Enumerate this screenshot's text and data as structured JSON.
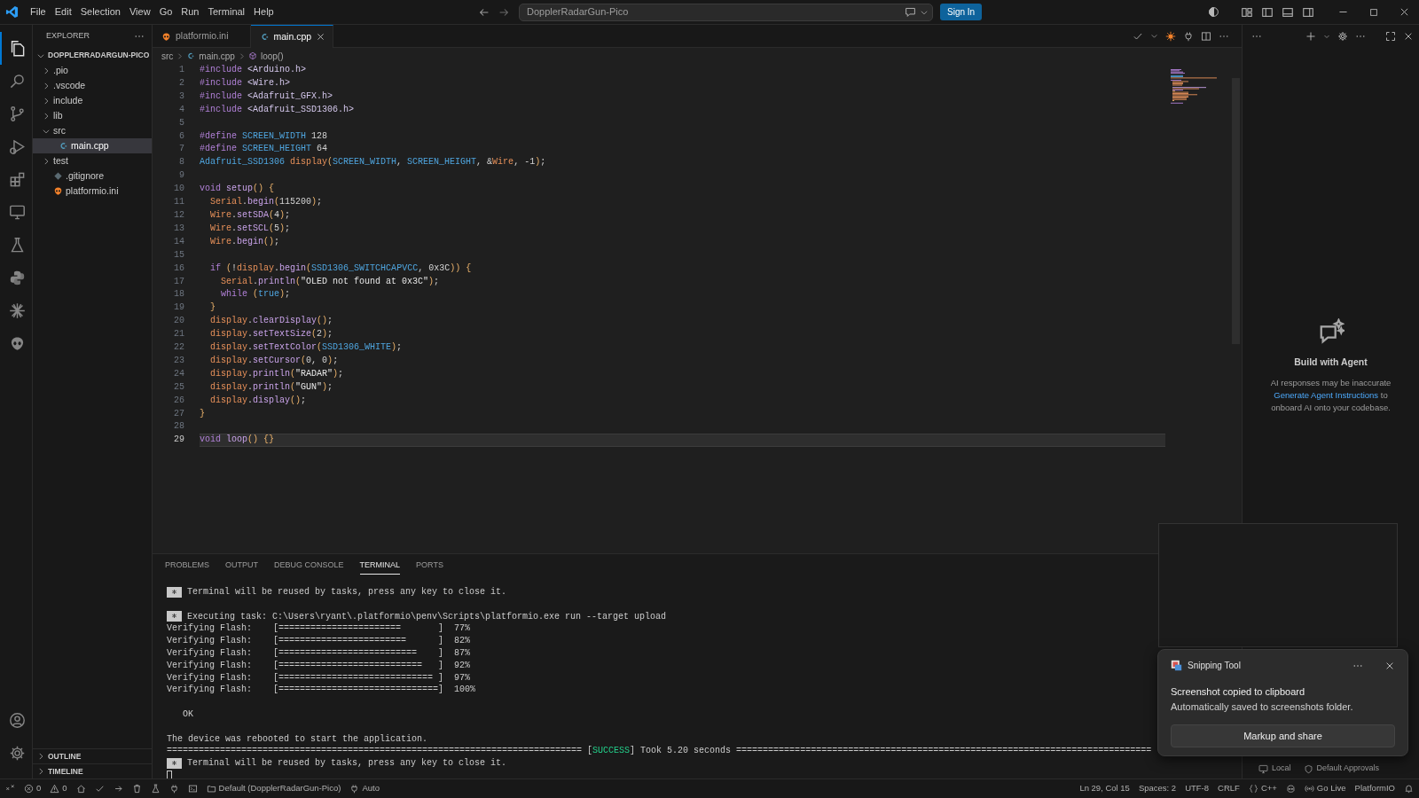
{
  "title_bar": {
    "menu": [
      "File",
      "Edit",
      "Selection",
      "View",
      "Go",
      "Run",
      "Terminal",
      "Help"
    ],
    "search": "DopplerRadarGun-Pico",
    "sign_in": "Sign In"
  },
  "activity_bar": [
    {
      "kind": "explorer",
      "selected": true
    },
    {
      "kind": "search",
      "selected": false
    },
    {
      "kind": "source_control",
      "selected": false
    },
    {
      "kind": "run",
      "selected": false
    },
    {
      "kind": "extensions",
      "selected": false
    },
    {
      "kind": "remote",
      "selected": false
    },
    {
      "kind": "testing",
      "selected": false
    },
    {
      "kind": "python",
      "selected": false
    },
    {
      "kind": "burst",
      "selected": false
    },
    {
      "kind": "platformio",
      "selected": false
    }
  ],
  "sidebar": {
    "title": "EXPLORER",
    "tree": [
      {
        "label": "DOPPLERRADARGUN-PICO",
        "kind": "root",
        "expanded": true,
        "selected": false,
        "children": [
          {
            "label": ".pio",
            "kind": "folder",
            "expanded": false,
            "selected": false
          },
          {
            "label": ".vscode",
            "kind": "folder",
            "expanded": false,
            "selected": false
          },
          {
            "label": "include",
            "kind": "folder",
            "expanded": false,
            "selected": false
          },
          {
            "label": "lib",
            "kind": "folder",
            "expanded": false,
            "selected": false
          },
          {
            "label": "src",
            "kind": "folder",
            "expanded": true,
            "selected": false,
            "children": [
              {
                "label": "main.cpp",
                "kind": "cpp",
                "selected": true
              }
            ]
          },
          {
            "label": "test",
            "kind": "folder",
            "expanded": false,
            "selected": false
          },
          {
            "label": ".gitignore",
            "kind": "git",
            "selected": false
          },
          {
            "label": "platformio.ini",
            "kind": "pio",
            "selected": false
          }
        ]
      }
    ],
    "sections": [
      {
        "label": "OUTLINE",
        "expanded": false
      },
      {
        "label": "TIMELINE",
        "expanded": false
      }
    ]
  },
  "tabs": [
    {
      "label": "platformio.ini",
      "kind": "pio",
      "selected": false
    },
    {
      "label": "main.cpp",
      "kind": "cpp",
      "selected": true
    }
  ],
  "breadcrumb": [
    {
      "label": "src",
      "kind": "folder"
    },
    {
      "label": "main.cpp",
      "kind": "cpp"
    },
    {
      "label": "loop()",
      "kind": "function"
    }
  ],
  "editor": {
    "lines": [
      {
        "number": "1",
        "current": false,
        "tokens": [
          {
            "kind": "pp",
            "text": "#include"
          },
          {
            "kind": "hdr",
            "text": " <Arduino.h>"
          }
        ]
      },
      {
        "number": "2",
        "current": false,
        "tokens": [
          {
            "kind": "pp",
            "text": "#include"
          },
          {
            "kind": "hdr",
            "text": " <Wire.h>"
          }
        ]
      },
      {
        "number": "3",
        "current": false,
        "tokens": [
          {
            "kind": "pp",
            "text": "#include"
          },
          {
            "kind": "hdr",
            "text": " <Adafruit_GFX.h>"
          }
        ]
      },
      {
        "number": "4",
        "current": false,
        "tokens": [
          {
            "kind": "pp",
            "text": "#include"
          },
          {
            "kind": "hdr",
            "text": " <Adafruit_SSD1306.h>"
          }
        ]
      },
      {
        "number": "5",
        "current": false
      },
      {
        "number": "6",
        "current": false,
        "tokens": [
          {
            "kind": "pp",
            "text": "#define"
          },
          {
            "kind": "mac",
            "text": " SCREEN_WIDTH"
          },
          {
            "kind": "num",
            "text": " 128"
          }
        ]
      },
      {
        "number": "7",
        "current": false,
        "tokens": [
          {
            "kind": "pp",
            "text": "#define"
          },
          {
            "kind": "mac",
            "text": " SCREEN_HEIGHT"
          },
          {
            "kind": "num",
            "text": " 64"
          }
        ]
      },
      {
        "number": "8",
        "current": false,
        "tokens": [
          {
            "kind": "cls",
            "text": "Adafruit_SSD1306"
          },
          {
            "kind": "var",
            "text": " display"
          },
          {
            "kind": "b",
            "text": "("
          },
          {
            "kind": "mac",
            "text": "SCREEN_WIDTH"
          },
          {
            "kind": "p",
            "text": ", "
          },
          {
            "kind": "mac",
            "text": "SCREEN_HEIGHT"
          },
          {
            "kind": "p",
            "text": ", &"
          },
          {
            "kind": "var",
            "text": "Wire"
          },
          {
            "kind": "p",
            "text": ", "
          },
          {
            "kind": "num",
            "text": "-1"
          },
          {
            "kind": "b",
            "text": ")"
          },
          {
            "kind": "p",
            "text": ";"
          }
        ]
      },
      {
        "number": "9",
        "current": false
      },
      {
        "number": "10",
        "current": false,
        "tokens": [
          {
            "kind": "kw",
            "text": "void"
          },
          {
            "kind": "fn",
            "text": " setup"
          },
          {
            "kind": "b",
            "text": "()"
          },
          {
            "kind": "b",
            "text": " {"
          }
        ]
      },
      {
        "number": "11",
        "current": false,
        "tokens": [
          {
            "kind": "var",
            "text": "  Serial"
          },
          {
            "kind": "p",
            "text": "."
          },
          {
            "kind": "fn",
            "text": "begin"
          },
          {
            "kind": "b",
            "text": "("
          },
          {
            "kind": "num",
            "text": "115200"
          },
          {
            "kind": "b",
            "text": ")"
          },
          {
            "kind": "p",
            "text": ";"
          }
        ]
      },
      {
        "number": "12",
        "current": false,
        "tokens": [
          {
            "kind": "var",
            "text": "  Wire"
          },
          {
            "kind": "p",
            "text": "."
          },
          {
            "kind": "fn",
            "text": "setSDA"
          },
          {
            "kind": "b",
            "text": "("
          },
          {
            "kind": "num",
            "text": "4"
          },
          {
            "kind": "b",
            "text": ")"
          },
          {
            "kind": "p",
            "text": ";"
          }
        ]
      },
      {
        "number": "13",
        "current": false,
        "tokens": [
          {
            "kind": "var",
            "text": "  Wire"
          },
          {
            "kind": "p",
            "text": "."
          },
          {
            "kind": "fn",
            "text": "setSCL"
          },
          {
            "kind": "b",
            "text": "("
          },
          {
            "kind": "num",
            "text": "5"
          },
          {
            "kind": "b",
            "text": ")"
          },
          {
            "kind": "p",
            "text": ";"
          }
        ]
      },
      {
        "number": "14",
        "current": false,
        "tokens": [
          {
            "kind": "var",
            "text": "  Wire"
          },
          {
            "kind": "p",
            "text": "."
          },
          {
            "kind": "fn",
            "text": "begin"
          },
          {
            "kind": "b",
            "text": "()"
          },
          {
            "kind": "p",
            "text": ";"
          }
        ]
      },
      {
        "number": "15",
        "current": false
      },
      {
        "number": "16",
        "current": false,
        "tokens": [
          {
            "kind": "kw",
            "text": "  if"
          },
          {
            "kind": "b",
            "text": " ("
          },
          {
            "kind": "p",
            "text": "!"
          },
          {
            "kind": "var",
            "text": "display"
          },
          {
            "kind": "p",
            "text": "."
          },
          {
            "kind": "fn",
            "text": "begin"
          },
          {
            "kind": "b",
            "text": "("
          },
          {
            "kind": "mac",
            "text": "SSD1306_SWITCHCAPVCC"
          },
          {
            "kind": "p",
            "text": ", "
          },
          {
            "kind": "num",
            "text": "0x3C"
          },
          {
            "kind": "b",
            "text": "))"
          },
          {
            "kind": "b",
            "text": " {"
          }
        ]
      },
      {
        "number": "17",
        "current": false,
        "tokens": [
          {
            "kind": "var",
            "text": "    Serial"
          },
          {
            "kind": "p",
            "text": "."
          },
          {
            "kind": "fn",
            "text": "println"
          },
          {
            "kind": "b",
            "text": "("
          },
          {
            "kind": "str",
            "text": "\"OLED not found at 0x3C\""
          },
          {
            "kind": "b",
            "text": ")"
          },
          {
            "kind": "p",
            "text": ";"
          }
        ]
      },
      {
        "number": "18",
        "current": false,
        "tokens": [
          {
            "kind": "kw",
            "text": "    while"
          },
          {
            "kind": "b",
            "text": " ("
          },
          {
            "kind": "lit",
            "text": "true"
          },
          {
            "kind": "b",
            "text": ")"
          },
          {
            "kind": "p",
            "text": ";"
          }
        ]
      },
      {
        "number": "19",
        "current": false,
        "tokens": [
          {
            "kind": "b",
            "text": "  }"
          }
        ]
      },
      {
        "number": "20",
        "current": false,
        "tokens": [
          {
            "kind": "var",
            "text": "  display"
          },
          {
            "kind": "p",
            "text": "."
          },
          {
            "kind": "fn",
            "text": "clearDisplay"
          },
          {
            "kind": "b",
            "text": "()"
          },
          {
            "kind": "p",
            "text": ";"
          }
        ]
      },
      {
        "number": "21",
        "current": false,
        "tokens": [
          {
            "kind": "var",
            "text": "  display"
          },
          {
            "kind": "p",
            "text": "."
          },
          {
            "kind": "fn",
            "text": "setTextSize"
          },
          {
            "kind": "b",
            "text": "("
          },
          {
            "kind": "num",
            "text": "2"
          },
          {
            "kind": "b",
            "text": ")"
          },
          {
            "kind": "p",
            "text": ";"
          }
        ]
      },
      {
        "number": "22",
        "current": false,
        "tokens": [
          {
            "kind": "var",
            "text": "  display"
          },
          {
            "kind": "p",
            "text": "."
          },
          {
            "kind": "fn",
            "text": "setTextColor"
          },
          {
            "kind": "b",
            "text": "("
          },
          {
            "kind": "mac",
            "text": "SSD1306_WHITE"
          },
          {
            "kind": "b",
            "text": ")"
          },
          {
            "kind": "p",
            "text": ";"
          }
        ]
      },
      {
        "number": "23",
        "current": false,
        "tokens": [
          {
            "kind": "var",
            "text": "  display"
          },
          {
            "kind": "p",
            "text": "."
          },
          {
            "kind": "fn",
            "text": "setCursor"
          },
          {
            "kind": "b",
            "text": "("
          },
          {
            "kind": "num",
            "text": "0"
          },
          {
            "kind": "p",
            "text": ", "
          },
          {
            "kind": "num",
            "text": "0"
          },
          {
            "kind": "b",
            "text": ")"
          },
          {
            "kind": "p",
            "text": ";"
          }
        ]
      },
      {
        "number": "24",
        "current": false,
        "tokens": [
          {
            "kind": "var",
            "text": "  display"
          },
          {
            "kind": "p",
            "text": "."
          },
          {
            "kind": "fn",
            "text": "println"
          },
          {
            "kind": "b",
            "text": "("
          },
          {
            "kind": "str",
            "text": "\"RADAR\""
          },
          {
            "kind": "b",
            "text": ")"
          },
          {
            "kind": "p",
            "text": ";"
          }
        ]
      },
      {
        "number": "25",
        "current": false,
        "tokens": [
          {
            "kind": "var",
            "text": "  display"
          },
          {
            "kind": "p",
            "text": "."
          },
          {
            "kind": "fn",
            "text": "println"
          },
          {
            "kind": "b",
            "text": "("
          },
          {
            "kind": "str",
            "text": "\"GUN\""
          },
          {
            "kind": "b",
            "text": ")"
          },
          {
            "kind": "p",
            "text": ";"
          }
        ]
      },
      {
        "number": "26",
        "current": false,
        "tokens": [
          {
            "kind": "var",
            "text": "  display"
          },
          {
            "kind": "p",
            "text": "."
          },
          {
            "kind": "fn",
            "text": "display"
          },
          {
            "kind": "b",
            "text": "()"
          },
          {
            "kind": "p",
            "text": ";"
          }
        ]
      },
      {
        "number": "27",
        "current": false,
        "tokens": [
          {
            "kind": "b",
            "text": "}"
          }
        ]
      },
      {
        "number": "28",
        "current": false
      },
      {
        "number": "29",
        "current": true,
        "tokens": [
          {
            "kind": "kw",
            "text": "void"
          },
          {
            "kind": "fn",
            "text": " loop"
          },
          {
            "kind": "b",
            "text": "()"
          },
          {
            "kind": "b",
            "text": " {}"
          }
        ]
      }
    ]
  },
  "panel": {
    "tabs": [
      {
        "label": "PROBLEMS",
        "selected": false
      },
      {
        "label": "OUTPUT",
        "selected": false
      },
      {
        "label": "DEBUG CONSOLE",
        "selected": false
      },
      {
        "label": "TERMINAL",
        "selected": true
      },
      {
        "label": "PORTS",
        "selected": false
      }
    ],
    "terminal": [
      {
        "kind": "task",
        "text": "Terminal will be reused by tasks, press any key to close it."
      },
      {
        "kind": "blank"
      },
      {
        "kind": "task",
        "text": "Executing task: C:\\Users\\ryant\\.platformio\\penv\\Scripts\\platformio.exe run --target upload"
      },
      {
        "kind": "plain",
        "text": "Verifying Flash:    [=======================       ]  77%"
      },
      {
        "kind": "plain",
        "text": "Verifying Flash:    [========================      ]  82%"
      },
      {
        "kind": "plain",
        "text": "Verifying Flash:    [==========================    ]  87%"
      },
      {
        "kind": "plain",
        "text": "Verifying Flash:    [===========================   ]  92%"
      },
      {
        "kind": "plain",
        "text": "Verifying Flash:    [============================= ]  97%"
      },
      {
        "kind": "plain",
        "text": "Verifying Flash:    [==============================]  100%"
      },
      {
        "kind": "blank"
      },
      {
        "kind": "result",
        "text": "OK"
      },
      {
        "kind": "blank"
      },
      {
        "kind": "plain",
        "text": "The device was rebooted to start the application."
      },
      {
        "kind": "success",
        "left": "============================================================================== [",
        "status": "SUCCESS",
        "right": "] Took 5.20 seconds =============================================================================="
      },
      {
        "kind": "task",
        "text": "Terminal will be reused by tasks, press any key to close it."
      },
      {
        "kind": "cursor"
      }
    ]
  },
  "chat": {
    "title": "Build with Agent",
    "note": "AI responses may be inaccurate",
    "link": "Generate Agent Instructions",
    "after_link": "to onboard AI onto your codebase.",
    "footer": [
      {
        "kind": "local",
        "label": "Local"
      },
      {
        "kind": "approvals",
        "label": "Default Approvals"
      }
    ]
  },
  "notification": {
    "app": "Snipping Tool",
    "title": "Screenshot copied to clipboard",
    "body": "Automatically saved to screenshots folder.",
    "action": "Markup and share"
  },
  "status_bar": {
    "left": [
      {
        "kind": "remote"
      },
      {
        "kind": "errors",
        "text": "0"
      },
      {
        "kind": "warnings",
        "text": "0"
      },
      {
        "kind": "home"
      },
      {
        "kind": "build"
      },
      {
        "kind": "upload"
      },
      {
        "kind": "clean"
      },
      {
        "kind": "test"
      },
      {
        "kind": "monitor"
      },
      {
        "kind": "terminal"
      },
      {
        "kind": "environment",
        "text": "Default (DopplerRadarGun-Pico)"
      },
      {
        "kind": "auto",
        "text": "Auto"
      }
    ],
    "right": [
      {
        "kind": "text",
        "text": "Ln 29, Col 15"
      },
      {
        "kind": "text",
        "text": "Spaces: 2"
      },
      {
        "kind": "text",
        "text": "UTF-8"
      },
      {
        "kind": "text",
        "text": "CRLF"
      },
      {
        "kind": "language",
        "text": "C++"
      },
      {
        "kind": "copilot"
      },
      {
        "kind": "live",
        "text": "Go Live"
      },
      {
        "kind": "text",
        "text": "PlatformIO"
      },
      {
        "kind": "bell"
      }
    ]
  }
}
